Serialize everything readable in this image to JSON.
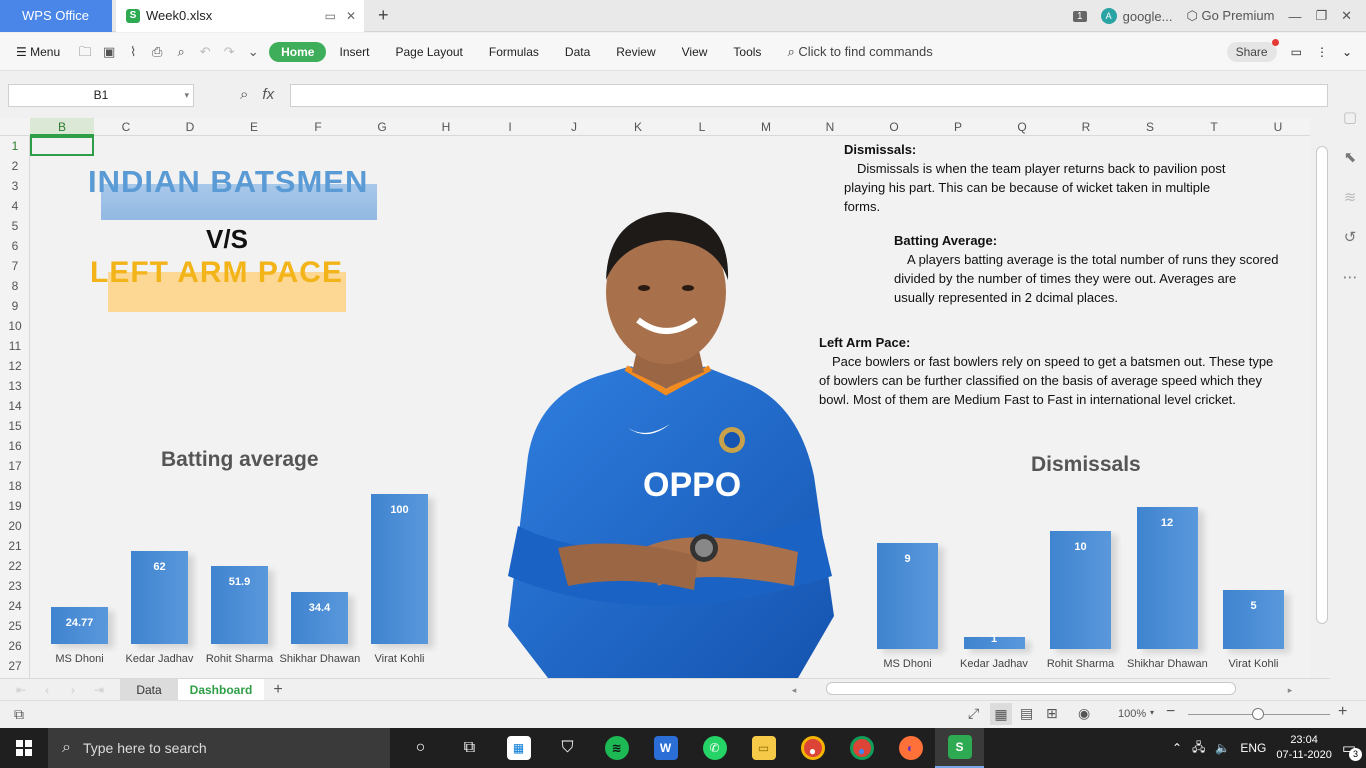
{
  "titlebar": {
    "app_tab": "WPS Office",
    "file_tab": "Week0.xlsx",
    "badge": "1",
    "account": "google...",
    "account_initial": "A",
    "premium": "Go Premium"
  },
  "menu": {
    "menu_label": "Menu",
    "items": [
      "Home",
      "Insert",
      "Page Layout",
      "Formulas",
      "Data",
      "Review",
      "View",
      "Tools"
    ],
    "search_placeholder": "Click to find commands",
    "share": "Share"
  },
  "formula": {
    "namebox": "B1",
    "fx": "fx",
    "value": ""
  },
  "columns": [
    "B",
    "C",
    "D",
    "E",
    "F",
    "G",
    "H",
    "I",
    "J",
    "K",
    "L",
    "M",
    "N",
    "O",
    "P",
    "Q",
    "R",
    "S",
    "T",
    "U"
  ],
  "rows": [
    "1",
    "2",
    "3",
    "4",
    "5",
    "6",
    "7",
    "8",
    "9",
    "10",
    "11",
    "12",
    "13",
    "14",
    "15",
    "16",
    "17",
    "18",
    "19",
    "20",
    "21",
    "22",
    "23",
    "24",
    "25",
    "26",
    "27"
  ],
  "dashboard": {
    "title_line1": "INDIAN BATSMEN",
    "title_vs": "V/S",
    "title_line2": "LEFT ARM PACE",
    "dismissals_heading": "Dismissals:",
    "dismissals_text": "Dismissals is when the team player returns back to pavilion post playing his part. This can be because of wicket taken in multiple forms.",
    "average_heading": "Batting Average:",
    "average_text": "A players batting average is the total number of runs they scored divided by the number of times they were out. Averages are usually represented in 2 dcimal places.",
    "pace_heading": "Left Arm Pace:",
    "pace_text": "Pace bowlers or fast bowlers rely on speed to get a batsmen out. These type of bowlers can be further classified on the basis of average speed which they bowl. Most of them are Medium Fast to Fast in international level cricket."
  },
  "chart_data": [
    {
      "type": "bar",
      "title": "Batting average",
      "categories": [
        "MS Dhoni",
        "Kedar Jadhav",
        "Rohit Sharma",
        "Shikhar Dhawan",
        "Virat Kohli"
      ],
      "values": [
        24.77,
        62,
        51.9,
        34.4,
        100
      ],
      "data_labels": [
        "24.77",
        "62",
        "51.9",
        "34.4",
        "100"
      ],
      "ylim": [
        0,
        100
      ],
      "color": "#4a8fd8"
    },
    {
      "type": "bar",
      "title": "Dismissals",
      "categories": [
        "MS Dhoni",
        "Kedar Jadhav",
        "Rohit Sharma",
        "Shikhar Dhawan",
        "Virat Kohli"
      ],
      "values": [
        9,
        1,
        10,
        12,
        5
      ],
      "data_labels": [
        "9",
        "1",
        "10",
        "12",
        "5"
      ],
      "ylim": [
        0,
        12
      ],
      "color": "#4a8fd8"
    }
  ],
  "sheet_tabs": [
    "Data",
    "Dashboard"
  ],
  "active_sheet": "Dashboard",
  "status": {
    "zoom": "100%"
  },
  "taskbar": {
    "search_placeholder": "Type here to search",
    "language": "ENG",
    "time": "23:04",
    "date": "07-11-2020",
    "notifications": "3"
  }
}
